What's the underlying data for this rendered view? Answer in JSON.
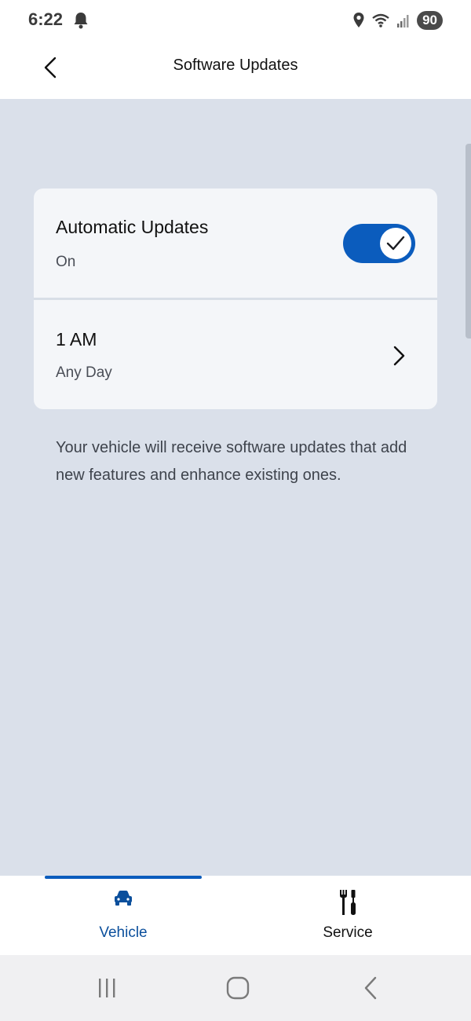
{
  "status_bar": {
    "time": "6:22",
    "battery": "90",
    "icons": [
      "bell-icon",
      "location-icon",
      "wifi-icon",
      "signal-icon",
      "battery-icon"
    ]
  },
  "header": {
    "title": "Software Updates",
    "back_icon": "chevron-left-icon"
  },
  "settings": {
    "automatic_updates": {
      "title": "Automatic Updates",
      "status": "On",
      "enabled": true
    },
    "schedule": {
      "time": "1 AM",
      "day": "Any Day",
      "icon": "chevron-right-icon"
    }
  },
  "description": "Your vehicle will receive software updates that add new features and enhance existing ones.",
  "bottom_nav": {
    "items": [
      {
        "label": "Vehicle",
        "icon": "car-icon",
        "active": true
      },
      {
        "label": "Service",
        "icon": "tools-icon",
        "active": false
      }
    ]
  },
  "colors": {
    "accent": "#0b5cbd",
    "background": "#dae0ea",
    "card": "#f4f6f9"
  }
}
